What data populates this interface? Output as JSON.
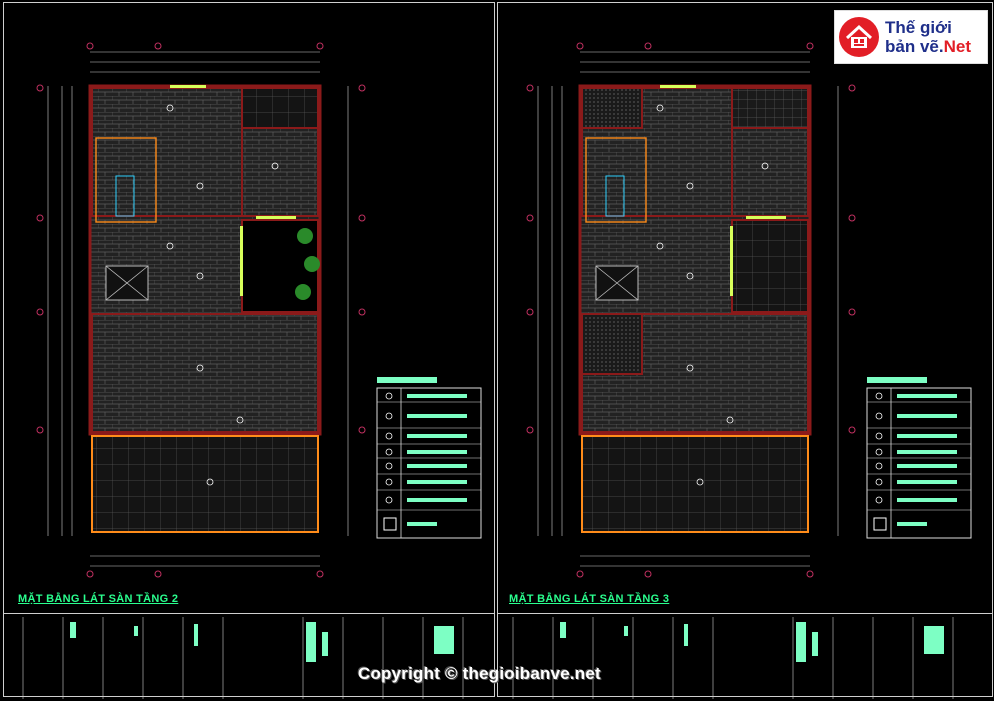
{
  "plans": [
    {
      "title": "MẶT BẰNG LÁT SÀN TẦNG 2"
    },
    {
      "title": "MẶT BẰNG LÁT SÀN TẦNG 3"
    }
  ],
  "logo": {
    "line1": "Thế giới",
    "line2_main": "bản vẽ.",
    "line2_accent": "Net"
  },
  "watermark": "Copyright © thegioibanve.net",
  "colors": {
    "background": "#000000",
    "wall": "#8b1a1a",
    "dimension": "#cfcfcf",
    "tile": "#5a5a5a",
    "accent_green": "#2aff8f",
    "legend_cyan": "#7dffc4",
    "balcony": "#ff8c1a",
    "stair": "#ff8c1a",
    "logo_red": "#e21e26",
    "logo_blue": "#1f2f8a"
  }
}
